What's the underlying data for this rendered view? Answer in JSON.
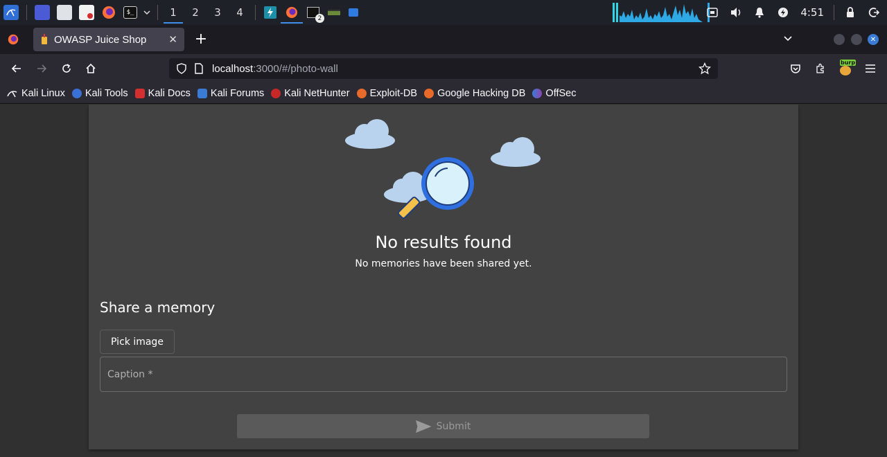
{
  "taskbar": {
    "workspaces": [
      "1",
      "2",
      "3",
      "4"
    ],
    "active_workspace": "1",
    "terminal_badge": "2",
    "clock": "4:51"
  },
  "browser": {
    "tab_title": "OWASP Juice Shop",
    "url_host": "localhost",
    "url_rest": ":3000/#/photo-wall",
    "bookmarks": [
      "Kali Linux",
      "Kali Tools",
      "Kali Docs",
      "Kali Forums",
      "Kali NetHunter",
      "Exploit-DB",
      "Google Hacking DB",
      "OffSec"
    ],
    "extension_badge": "burp"
  },
  "page": {
    "empty_title": "No results found",
    "empty_subtitle": "No memories have been shared yet.",
    "share_title": "Share a memory",
    "pick_image_label": "Pick image",
    "caption_placeholder": "Caption *",
    "submit_label": "Submit"
  },
  "colors": {
    "accent": "#3f8fe8",
    "card_bg": "#424242",
    "page_bg": "#303030"
  }
}
